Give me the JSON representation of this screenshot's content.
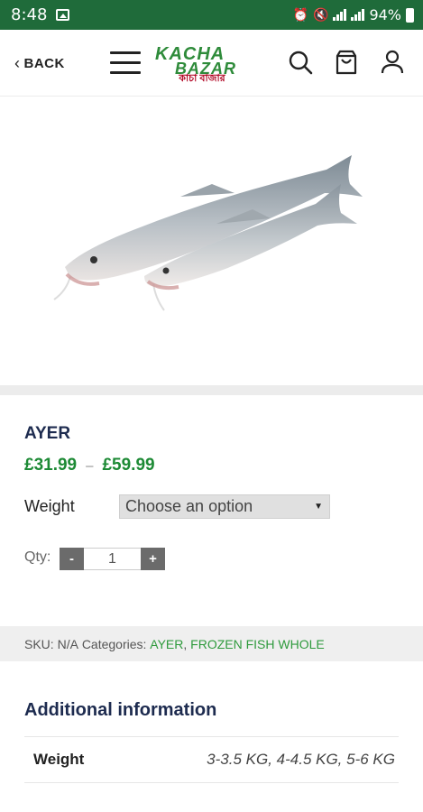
{
  "status_bar": {
    "time": "8:48",
    "battery": "94%",
    "icons": [
      "image-icon",
      "alarm-icon",
      "mute-icon",
      "data-icon",
      "signal-icon",
      "signal-icon",
      "battery-icon"
    ]
  },
  "header": {
    "back_label": "BACK",
    "logo_text_line1": "KACHA",
    "logo_text_line2": "BAZAR",
    "logo_bengali": "কাচা বাজার",
    "icons": [
      "menu-icon",
      "search-icon",
      "cart-icon",
      "user-icon"
    ]
  },
  "product": {
    "image_subject": "fish-image",
    "title": "AYER",
    "price_min": "£31.99",
    "price_sep": "–",
    "price_max": "£59.99",
    "weight_label": "Weight",
    "weight_placeholder": "Choose an option",
    "qty_label": "Qty:",
    "qty_minus": "-",
    "qty_value": "1",
    "qty_plus": "+"
  },
  "meta": {
    "sku_label": "SKU:",
    "sku_value": "N/A",
    "categories_label": "Categories:",
    "categories": [
      "AYER",
      "FROZEN FISH WHOLE"
    ],
    "category_separator": ","
  },
  "additional_info": {
    "heading": "Additional information",
    "rows": [
      {
        "key": "Weight",
        "value": "3-3.5 KG, 4-4.5 KG, 5-6 KG"
      }
    ]
  },
  "colors": {
    "status_bar": "#1f6b3a",
    "brand_green": "#2e8b3a",
    "price_green": "#1d8a35",
    "heading_navy": "#1d2b4f"
  }
}
